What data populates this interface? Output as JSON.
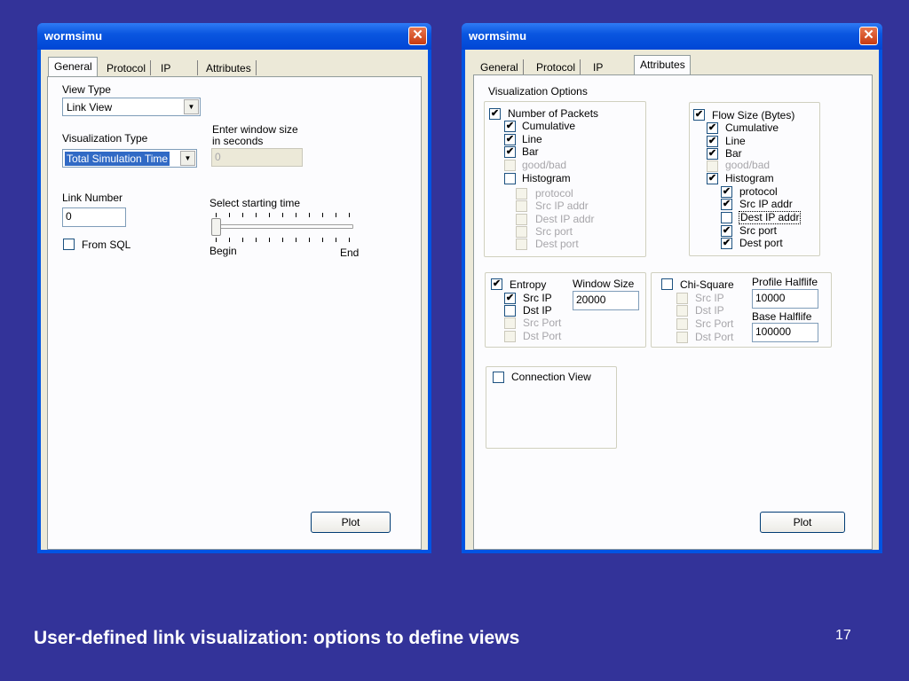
{
  "slide": {
    "caption": "User-defined link visualization: options to define views",
    "page_number": "17"
  },
  "win1": {
    "title": "wormsimu",
    "close": "✕",
    "tabs": [
      "General",
      "Protocol",
      "IP",
      "Attributes"
    ],
    "active_tab": "General",
    "view_type_label": "View Type",
    "view_type_value": "Link View",
    "vis_type_label": "Visualization Type",
    "vis_type_value": "Total Simulation Time",
    "window_size_label_1": "Enter window size",
    "window_size_label_2": "in seconds",
    "window_size_value": "0",
    "link_number_label": "Link Number",
    "link_number_value": "0",
    "from_sql_label": "From SQL",
    "slider_label": "Select starting time",
    "slider_begin": "Begin",
    "slider_end": "End",
    "plot_label": "Plot"
  },
  "win2": {
    "title": "wormsimu",
    "close": "✕",
    "tabs": [
      "General",
      "Protocol",
      "IP",
      "Attributes"
    ],
    "active_tab": "Attributes",
    "vis_options_label": "Visualization Options",
    "packets": {
      "label": "Number of Packets",
      "cumulative": "Cumulative",
      "line": "Line",
      "bar": "Bar",
      "goodbad": "good/bad",
      "histogram": "Histogram",
      "protocol": "protocol",
      "src_ip_addr": "Src IP addr",
      "dest_ip_addr": "Dest IP addr",
      "src_port": "Src port",
      "dest_port": "Dest port"
    },
    "bytes": {
      "label": "Flow Size (Bytes)",
      "cumulative": "Cumulative",
      "line": "Line",
      "bar": "Bar",
      "goodbad": "good/bad",
      "histogram": "Histogram",
      "protocol": "protocol",
      "src_ip_addr": "Src IP addr",
      "dest_ip_addr": "Dest IP addr",
      "src_port": "Src port",
      "dest_port": "Dest port"
    },
    "entropy": {
      "label": "Entropy",
      "window_size_label": "Window Size",
      "window_size_value": "20000",
      "src_ip": "Src IP",
      "dst_ip": "Dst IP",
      "src_port": "Src Port",
      "dst_port": "Dst Port"
    },
    "chisquare": {
      "label": "Chi-Square",
      "profile_label": "Profile Halflife",
      "profile_value": "10000",
      "base_label": "Base Halflife",
      "base_value": "100000",
      "src_ip": "Src IP",
      "dst_ip": "Dst IP",
      "src_port": "Src Port",
      "dst_port": "Dst Port"
    },
    "connection_view": "Connection View",
    "plot_label": "Plot"
  },
  "check": "✔"
}
